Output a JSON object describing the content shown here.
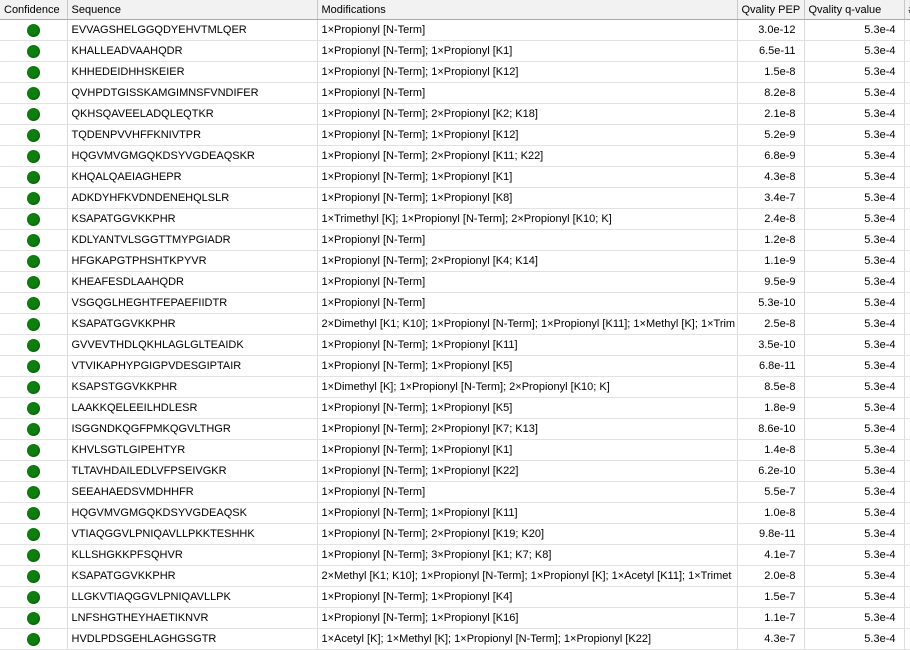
{
  "columns": [
    "Confidence",
    "Sequence",
    "Modifications",
    "Qvality PEP",
    "Qvality q-value",
    "#"
  ],
  "confidence_color": "#0d7f0d",
  "confidence_icon": "green-circle-icon",
  "rows": [
    {
      "confidence": "high",
      "sequence": "EVVAGSHELGGQDYEHVTMLQER",
      "modifications": "1×Propionyl [N-Term]",
      "pep": "3.0e-12",
      "qvalue": "5.3e-4"
    },
    {
      "confidence": "high",
      "sequence": "KHALLEADVAAHQDR",
      "modifications": "1×Propionyl [N-Term]; 1×Propionyl [K1]",
      "pep": "6.5e-11",
      "qvalue": "5.3e-4"
    },
    {
      "confidence": "high",
      "sequence": "KHHEDEIDHHSKEIER",
      "modifications": "1×Propionyl [N-Term]; 1×Propionyl [K12]",
      "pep": "1.5e-8",
      "qvalue": "5.3e-4"
    },
    {
      "confidence": "high",
      "sequence": "QVHPDTGISSKAMGIMNSFVNDIFER",
      "modifications": "1×Propionyl [N-Term]",
      "pep": "8.2e-8",
      "qvalue": "5.3e-4"
    },
    {
      "confidence": "high",
      "sequence": "QKHSQAVEELADQLEQTKR",
      "modifications": "1×Propionyl [N-Term]; 2×Propionyl [K2; K18]",
      "pep": "2.1e-8",
      "qvalue": "5.3e-4"
    },
    {
      "confidence": "high",
      "sequence": "TQDENPVVHFFKNIVTPR",
      "modifications": "1×Propionyl [N-Term]; 1×Propionyl [K12]",
      "pep": "5.2e-9",
      "qvalue": "5.3e-4"
    },
    {
      "confidence": "high",
      "sequence": "HQGVMVGMGQKDSYVGDEAQSKR",
      "modifications": "1×Propionyl [N-Term]; 2×Propionyl [K11; K22]",
      "pep": "6.8e-9",
      "qvalue": "5.3e-4"
    },
    {
      "confidence": "high",
      "sequence": "KHQALQAEIAGHEPR",
      "modifications": "1×Propionyl [N-Term]; 1×Propionyl [K1]",
      "pep": "4.3e-8",
      "qvalue": "5.3e-4"
    },
    {
      "confidence": "high",
      "sequence": "ADKDYHFKVDNDENEHQLSLR",
      "modifications": "1×Propionyl [N-Term]; 1×Propionyl [K8]",
      "pep": "3.4e-7",
      "qvalue": "5.3e-4"
    },
    {
      "confidence": "high",
      "sequence": "KSAPATGGVKKPHR",
      "modifications": "1×Trimethyl [K]; 1×Propionyl [N-Term]; 2×Propionyl [K10; K]",
      "pep": "2.4e-8",
      "qvalue": "5.3e-4"
    },
    {
      "confidence": "high",
      "sequence": "KDLYANTVLSGGTTMYPGIADR",
      "modifications": "1×Propionyl [N-Term]",
      "pep": "1.2e-8",
      "qvalue": "5.3e-4"
    },
    {
      "confidence": "high",
      "sequence": "HFGKAPGTPHSHTKPYVR",
      "modifications": "1×Propionyl [N-Term]; 2×Propionyl [K4; K14]",
      "pep": "1.1e-9",
      "qvalue": "5.3e-4"
    },
    {
      "confidence": "high",
      "sequence": "KHEAFESDLAAHQDR",
      "modifications": "1×Propionyl [N-Term]",
      "pep": "9.5e-9",
      "qvalue": "5.3e-4"
    },
    {
      "confidence": "high",
      "sequence": "VSGQGLHEGHTFEPAEFIIDTR",
      "modifications": "1×Propionyl [N-Term]",
      "pep": "5.3e-10",
      "qvalue": "5.3e-4"
    },
    {
      "confidence": "high",
      "sequence": "KSAPATGGVKKPHR",
      "modifications": "2×Dimethyl [K1; K10]; 1×Propionyl [N-Term]; 1×Propionyl [K11]; 1×Methyl [K]; 1×Trim",
      "pep": "2.5e-8",
      "qvalue": "5.3e-4"
    },
    {
      "confidence": "high",
      "sequence": "GVVEVTHDLQKHLAGLGLTEAIDK",
      "modifications": "1×Propionyl [N-Term]; 1×Propionyl [K11]",
      "pep": "3.5e-10",
      "qvalue": "5.3e-4"
    },
    {
      "confidence": "high",
      "sequence": "VTVIKAPHYPGIGPVDESGIPTAIR",
      "modifications": "1×Propionyl [N-Term]; 1×Propionyl [K5]",
      "pep": "6.8e-11",
      "qvalue": "5.3e-4"
    },
    {
      "confidence": "high",
      "sequence": "KSAPSTGGVKKPHR",
      "modifications": "1×Dimethyl [K]; 1×Propionyl [N-Term]; 2×Propionyl [K10; K]",
      "pep": "8.5e-8",
      "qvalue": "5.3e-4"
    },
    {
      "confidence": "high",
      "sequence": "LAAKKQELEEILHDLESR",
      "modifications": "1×Propionyl [N-Term]; 1×Propionyl [K5]",
      "pep": "1.8e-9",
      "qvalue": "5.3e-4"
    },
    {
      "confidence": "high",
      "sequence": "ISGGNDKQGFPMKQGVLTHGR",
      "modifications": "1×Propionyl [N-Term]; 2×Propionyl [K7; K13]",
      "pep": "8.6e-10",
      "qvalue": "5.3e-4"
    },
    {
      "confidence": "high",
      "sequence": "KHVLSGTLGIPEHTYR",
      "modifications": "1×Propionyl [N-Term]; 1×Propionyl [K1]",
      "pep": "1.4e-8",
      "qvalue": "5.3e-4"
    },
    {
      "confidence": "high",
      "sequence": "TLTAVHDAILEDLVFPSEIVGKR",
      "modifications": "1×Propionyl [N-Term]; 1×Propionyl [K22]",
      "pep": "6.2e-10",
      "qvalue": "5.3e-4"
    },
    {
      "confidence": "high",
      "sequence": "SEEAHAEDSVMDHHFR",
      "modifications": "1×Propionyl [N-Term]",
      "pep": "5.5e-7",
      "qvalue": "5.3e-4"
    },
    {
      "confidence": "high",
      "sequence": "HQGVMVGMGQKDSYVGDEAQSK",
      "modifications": "1×Propionyl [N-Term]; 1×Propionyl [K11]",
      "pep": "1.0e-8",
      "qvalue": "5.3e-4"
    },
    {
      "confidence": "high",
      "sequence": "VTIAQGGVLPNIQAVLLPKKTESHHK",
      "modifications": "1×Propionyl [N-Term]; 2×Propionyl [K19; K20]",
      "pep": "9.8e-11",
      "qvalue": "5.3e-4"
    },
    {
      "confidence": "high",
      "sequence": "KLLSHGKKPFSQHVR",
      "modifications": "1×Propionyl [N-Term]; 3×Propionyl [K1; K7; K8]",
      "pep": "4.1e-7",
      "qvalue": "5.3e-4"
    },
    {
      "confidence": "high",
      "sequence": "KSAPATGGVKKPHR",
      "modifications": "2×Methyl [K1; K10]; 1×Propionyl [N-Term]; 1×Propionyl [K]; 1×Acetyl [K11]; 1×Trimet",
      "pep": "2.0e-8",
      "qvalue": "5.3e-4"
    },
    {
      "confidence": "high",
      "sequence": "LLGKVTIAQGGVLPNIQAVLLPK",
      "modifications": "1×Propionyl [N-Term]; 1×Propionyl [K4]",
      "pep": "1.5e-7",
      "qvalue": "5.3e-4"
    },
    {
      "confidence": "high",
      "sequence": "LNFSHGTHEYHAETIKNVR",
      "modifications": "1×Propionyl [N-Term]; 1×Propionyl [K16]",
      "pep": "1.1e-7",
      "qvalue": "5.3e-4"
    },
    {
      "confidence": "high",
      "sequence": "HVDLPDSGEHLAGHGSGTR",
      "modifications": "1×Acetyl [K]; 1×Methyl [K]; 1×Propionyl [N-Term]; 1×Propionyl [K22]",
      "pep": "4.3e-7",
      "qvalue": "5.3e-4"
    }
  ]
}
